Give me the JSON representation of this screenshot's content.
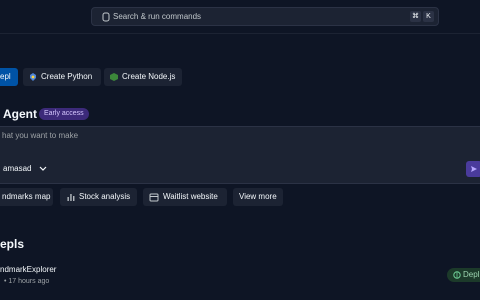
{
  "search": {
    "placeholder": "Search & run commands",
    "shortcut_mod": "⌘",
    "shortcut_key": "K"
  },
  "create": {
    "repl_label": "epl",
    "python_label": "Create Python",
    "node_label": "Create Node.js"
  },
  "agent": {
    "title": "Agent",
    "badge": "Early access",
    "placeholder": "hat you want to make",
    "owner": "amasad"
  },
  "suggestions": [
    {
      "label": "ndmarks map",
      "icon": "map-icon"
    },
    {
      "label": "Stock analysis",
      "icon": "chart-icon"
    },
    {
      "label": "Waitlist website",
      "icon": "calendar-icon"
    },
    {
      "label": "View more"
    }
  ],
  "repls": {
    "title": "epls",
    "items": [
      {
        "name": "ndmarkExplorer",
        "meta": "• 17 hours ago",
        "badge": "Depl"
      }
    ]
  },
  "colors": {
    "background": "#0e1525",
    "surface": "#1c2333",
    "primary": "#0053a6",
    "accent_purple": "#4a3b9c"
  }
}
